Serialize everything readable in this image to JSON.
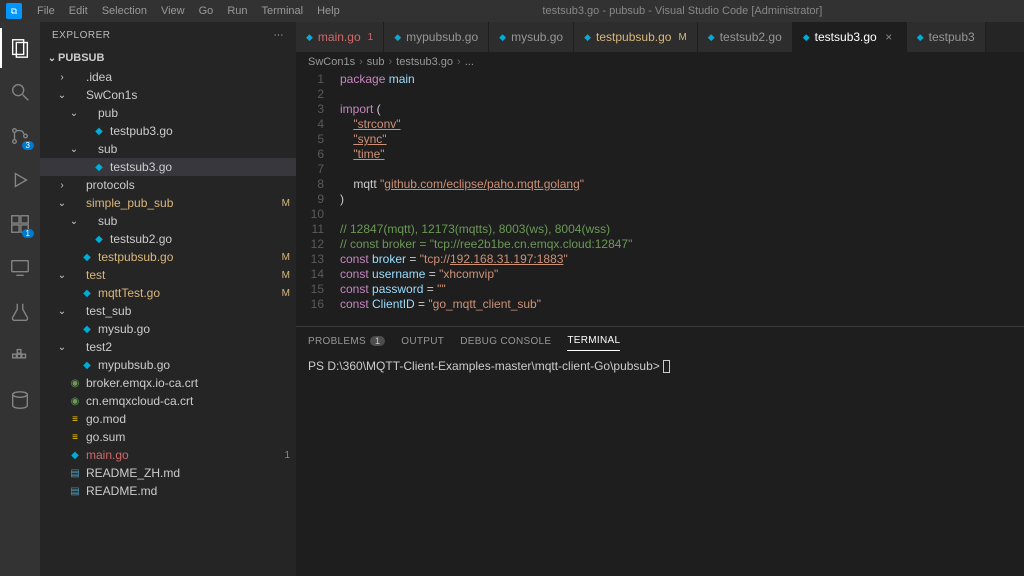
{
  "titlebar": {
    "menu": [
      "File",
      "Edit",
      "Selection",
      "View",
      "Go",
      "Run",
      "Terminal",
      "Help"
    ],
    "title": "testsub3.go - pubsub - Visual Studio Code [Administrator]"
  },
  "sidebar": {
    "header": "EXPLORER",
    "root": "PUBSUB",
    "tree": [
      {
        "d": 1,
        "t": "folder",
        "label": ".idea",
        "exp": false
      },
      {
        "d": 1,
        "t": "folder",
        "label": "SwCon1s",
        "exp": true
      },
      {
        "d": 2,
        "t": "folder",
        "label": "pub",
        "exp": true
      },
      {
        "d": 3,
        "t": "go",
        "label": "testpub3.go"
      },
      {
        "d": 2,
        "t": "folder",
        "label": "sub",
        "exp": true
      },
      {
        "d": 3,
        "t": "go",
        "label": "testsub3.go",
        "sel": true
      },
      {
        "d": 1,
        "t": "folder",
        "label": "protocols",
        "exp": false
      },
      {
        "d": 1,
        "t": "folder",
        "label": "simple_pub_sub",
        "exp": true,
        "m": true
      },
      {
        "d": 2,
        "t": "folder",
        "label": "sub",
        "exp": true
      },
      {
        "d": 3,
        "t": "go",
        "label": "testsub2.go"
      },
      {
        "d": 2,
        "t": "go",
        "label": "testpubsub.go",
        "m": true
      },
      {
        "d": 1,
        "t": "folder",
        "label": "test",
        "exp": true,
        "m": true
      },
      {
        "d": 2,
        "t": "go",
        "label": "mqttTest.go",
        "m": true
      },
      {
        "d": 1,
        "t": "folder",
        "label": "test_sub",
        "exp": true
      },
      {
        "d": 2,
        "t": "go",
        "label": "mysub.go"
      },
      {
        "d": 1,
        "t": "folder",
        "label": "test2",
        "exp": true
      },
      {
        "d": 2,
        "t": "go",
        "label": "mypubsub.go"
      },
      {
        "d": 1,
        "t": "cert",
        "label": "broker.emqx.io-ca.crt"
      },
      {
        "d": 1,
        "t": "cert",
        "label": "cn.emqxcloud-ca.crt"
      },
      {
        "d": 1,
        "t": "mod",
        "label": "go.mod"
      },
      {
        "d": 1,
        "t": "mod",
        "label": "go.sum"
      },
      {
        "d": 1,
        "t": "go",
        "label": "main.go",
        "err": true
      },
      {
        "d": 1,
        "t": "md",
        "label": "README_ZH.md"
      },
      {
        "d": 1,
        "t": "md",
        "label": "README.md"
      }
    ]
  },
  "tabs": [
    {
      "label": "main.go",
      "err": true,
      "stat": "1"
    },
    {
      "label": "mypubsub.go"
    },
    {
      "label": "mysub.go"
    },
    {
      "label": "testpubsub.go",
      "m": true,
      "stat": "M"
    },
    {
      "label": "testsub2.go"
    },
    {
      "label": "testsub3.go",
      "active": true,
      "close": true
    },
    {
      "label": "testpub3"
    }
  ],
  "crumbs": [
    "SwCon1s",
    "sub",
    "testsub3.go",
    "..."
  ],
  "code": {
    "start": 1,
    "lines": [
      [
        {
          "c": "kw",
          "t": "package "
        },
        {
          "c": "id",
          "t": "main"
        }
      ],
      [],
      [
        {
          "c": "kw",
          "t": "import"
        },
        {
          "t": " ("
        }
      ],
      [
        {
          "t": "    "
        },
        {
          "c": "str lnk",
          "t": "\"strconv\""
        }
      ],
      [
        {
          "t": "    "
        },
        {
          "c": "str lnk",
          "t": "\"sync\""
        }
      ],
      [
        {
          "t": "    "
        },
        {
          "c": "str lnk",
          "t": "\"time\""
        }
      ],
      [],
      [
        {
          "t": "    mqtt "
        },
        {
          "c": "str",
          "t": "\""
        },
        {
          "c": "str lnk",
          "t": "github.com/eclipse/paho.mqtt.golang"
        },
        {
          "c": "str",
          "t": "\""
        }
      ],
      [
        {
          "t": ")"
        }
      ],
      [],
      [
        {
          "c": "com",
          "t": "// 12847(mqtt), 12173(mqtts), 8003(ws), 8004(wss)"
        }
      ],
      [
        {
          "c": "com",
          "t": "// const broker = \"tcp://ree2b1be.cn.emqx.cloud:12847\""
        }
      ],
      [
        {
          "c": "kw",
          "t": "const "
        },
        {
          "c": "id",
          "t": "broker"
        },
        {
          "t": " = "
        },
        {
          "c": "str",
          "t": "\"tcp://"
        },
        {
          "c": "str lnk",
          "t": "192.168.31.197:1883"
        },
        {
          "c": "str",
          "t": "\""
        }
      ],
      [
        {
          "c": "kw",
          "t": "const "
        },
        {
          "c": "id",
          "t": "username"
        },
        {
          "t": " = "
        },
        {
          "c": "str",
          "t": "\"xhcomvip\""
        }
      ],
      [
        {
          "c": "kw",
          "t": "const "
        },
        {
          "c": "id",
          "t": "password"
        },
        {
          "t": " = "
        },
        {
          "c": "str",
          "t": "\"\""
        }
      ],
      [
        {
          "c": "kw",
          "t": "const "
        },
        {
          "c": "id",
          "t": "ClientID"
        },
        {
          "t": " = "
        },
        {
          "c": "str",
          "t": "\"go_mqtt_client_sub\""
        }
      ]
    ]
  },
  "panel": {
    "tabs": [
      {
        "label": "PROBLEMS",
        "count": "1"
      },
      {
        "label": "OUTPUT"
      },
      {
        "label": "DEBUG CONSOLE"
      },
      {
        "label": "TERMINAL",
        "active": true
      }
    ],
    "prompt": "PS D:\\360\\MQTT-Client-Examples-master\\mqtt-client-Go\\pubsub> "
  }
}
